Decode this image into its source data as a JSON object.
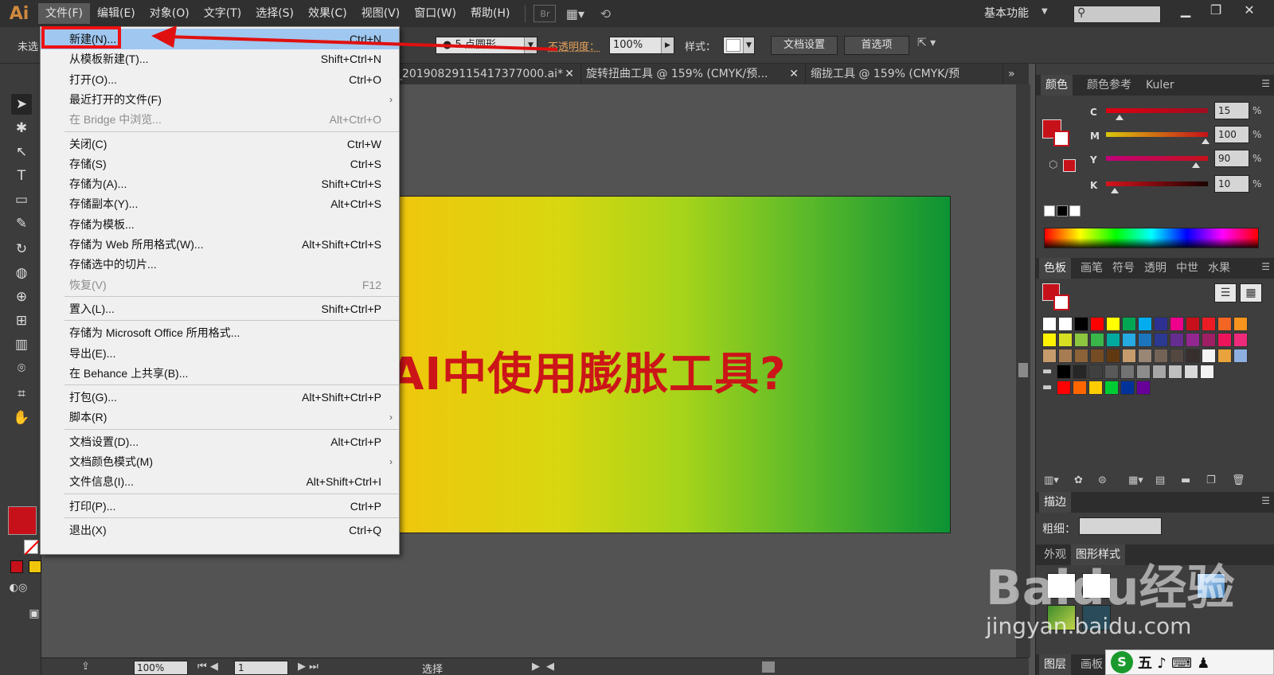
{
  "app": {
    "logo": "Ai",
    "workspace": "基本功能"
  },
  "menubar": [
    {
      "label": "文件(F)",
      "active": true
    },
    {
      "label": "编辑(E)"
    },
    {
      "label": "对象(O)"
    },
    {
      "label": "文字(T)"
    },
    {
      "label": "选择(S)"
    },
    {
      "label": "效果(C)"
    },
    {
      "label": "视图(V)"
    },
    {
      "label": "窗口(W)"
    },
    {
      "label": "帮助(H)"
    }
  ],
  "menubar_icons": {
    "bridge": "Br"
  },
  "controlbar": {
    "selection_status": "未选",
    "stroke_profile": "● 5 点圆形",
    "opacity_label": "不透明度：",
    "opacity_value": "100%",
    "style_label": "样式：",
    "doc_setup_button": "文档设置",
    "preferences_button": "首选项"
  },
  "doc_tabs": [
    "_20190829115417377000.ai*",
    "旋转扭曲工具 @ 159% (CMYK/预...",
    "缩拢工具 @ 159% (CMYK/预"
  ],
  "artboard": {
    "title": "AI中使用膨胀工具?",
    "title_color": "#cc1518",
    "gradient_colors": [
      "#f0c60c",
      "#a6d41a",
      "#0c9234"
    ]
  },
  "file_menu": {
    "items": [
      {
        "label": "新建(N)...",
        "shortcut": "Ctrl+N",
        "highlight": true
      },
      {
        "label": "从模板新建(T)...",
        "shortcut": "Shift+Ctrl+N"
      },
      {
        "label": "打开(O)...",
        "shortcut": "Ctrl+O"
      },
      {
        "label": "最近打开的文件(F)",
        "shortcut": "",
        "submenu": true
      },
      {
        "label": "在 Bridge 中浏览...",
        "shortcut": "Alt+Ctrl+O",
        "disabled": true
      },
      {
        "label": "关闭(C)",
        "shortcut": "Ctrl+W",
        "sep_before": true
      },
      {
        "label": "存储(S)",
        "shortcut": "Ctrl+S"
      },
      {
        "label": "存储为(A)...",
        "shortcut": "Shift+Ctrl+S"
      },
      {
        "label": "存储副本(Y)...",
        "shortcut": "Alt+Ctrl+S"
      },
      {
        "label": "存储为模板...",
        "shortcut": ""
      },
      {
        "label": "存储为 Web 所用格式(W)...",
        "shortcut": "Alt+Shift+Ctrl+S"
      },
      {
        "label": "存储选中的切片...",
        "shortcut": ""
      },
      {
        "label": "恢复(V)",
        "shortcut": "F12",
        "disabled": true
      },
      {
        "label": "置入(L)...",
        "shortcut": "Shift+Ctrl+P",
        "sep_before": true
      },
      {
        "label": "存储为 Microsoft Office 所用格式...",
        "shortcut": "",
        "sep_before": true
      },
      {
        "label": "导出(E)...",
        "shortcut": ""
      },
      {
        "label": "在 Behance 上共享(B)...",
        "shortcut": ""
      },
      {
        "label": "打包(G)...",
        "shortcut": "Alt+Shift+Ctrl+P",
        "sep_before": true
      },
      {
        "label": "脚本(R)",
        "shortcut": "",
        "submenu": true
      },
      {
        "label": "文档设置(D)...",
        "shortcut": "Alt+Ctrl+P",
        "sep_before": true
      },
      {
        "label": "文档颜色模式(M)",
        "shortcut": "",
        "submenu": true
      },
      {
        "label": "文件信息(I)...",
        "shortcut": "Alt+Shift+Ctrl+I"
      },
      {
        "label": "打印(P)...",
        "shortcut": "Ctrl+P",
        "sep_before": true
      },
      {
        "label": "退出(X)",
        "shortcut": "Ctrl+Q",
        "sep_before": true
      }
    ]
  },
  "color_panel": {
    "tabs": [
      "颜色",
      "颜色参考",
      "Kuler"
    ],
    "fill_color": "#c7111a",
    "channels": [
      {
        "label": "C",
        "value": "15",
        "pct": "%"
      },
      {
        "label": "M",
        "value": "100",
        "pct": "%"
      },
      {
        "label": "Y",
        "value": "90",
        "pct": "%"
      },
      {
        "label": "K",
        "value": "10",
        "pct": "%"
      }
    ]
  },
  "swatches_panel": {
    "tabs": [
      "色板",
      "画笔",
      "符号",
      "透明",
      "中世",
      "水果"
    ],
    "rows": [
      [
        "#ffffff",
        "#ffffff",
        "#000000",
        "#ff0000",
        "#ffff00",
        "#00a651",
        "#00aeef",
        "#2e3192",
        "#ec008c",
        "#c7111a",
        "#ed1c24",
        "#f26522",
        "#f7941d"
      ],
      [
        "#fff200",
        "#d7df23",
        "#8dc63f",
        "#39b54a",
        "#00a99d",
        "#27aae1",
        "#1c75bc",
        "#2b3990",
        "#662d91",
        "#92278f",
        "#9e1f63",
        "#ed145b",
        "#ee2a7b"
      ],
      [
        "#c69c6d",
        "#a67c52",
        "#8c6239",
        "#754c24",
        "#603913",
        "#c69c6d",
        "#998675",
        "#736357",
        "#534741",
        "#362f2d",
        "#f4f4f4",
        "#e8a33c",
        "#8dafe0"
      ],
      [
        "#000000",
        "#262626",
        "#404040",
        "#595959",
        "#737373",
        "#8c8c8c",
        "#a6a6a6",
        "#bfbfbf",
        "#d9d9d9",
        "#f2f2f2"
      ],
      [
        "#ff0000",
        "#ff6600",
        "#ffcc00",
        "#00cc33",
        "#003399",
        "#660099"
      ]
    ]
  },
  "stroke_panel": {
    "title": "描边",
    "weight_label": "粗细："
  },
  "appearance_panel": {
    "tabs": [
      "外观",
      "图形样式"
    ]
  },
  "bottom_tabs": [
    "图层",
    "画板"
  ],
  "statusbar": {
    "zoom": "100%",
    "page": "1",
    "tool": "选择"
  },
  "watermark": {
    "main": "Baidu经验",
    "sub": "jingyan.baidu.com"
  },
  "ime": {
    "logo": "S",
    "text": "五 ♪ ⌨ ♟"
  }
}
